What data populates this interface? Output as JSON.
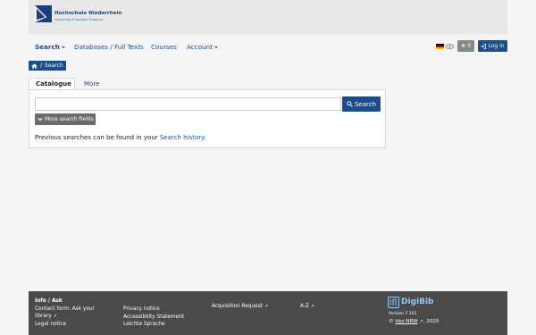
{
  "header": {
    "logo_name": "Hochschule Niederrhein",
    "logo_sub": "University of Applied Sciences"
  },
  "nav": {
    "search": "Search",
    "databases": "Databases / Full Texts",
    "courses": "Courses",
    "account": "Account",
    "bookmark_count": "0",
    "login": "Log in"
  },
  "breadcrumb": {
    "label": "Search"
  },
  "tabs": [
    {
      "label": "Catalogue"
    },
    {
      "label": "More"
    }
  ],
  "search": {
    "value": "",
    "button": "Search",
    "more_fields": "More search fields",
    "previous_text": "Previous searches can be found in your",
    "history_link": "Search history",
    "period": "."
  },
  "footer": {
    "col1": {
      "heading": "Info / Ask",
      "contact": "Contact form: Ask your",
      "library": "library",
      "legal": "Legal notice"
    },
    "col2": {
      "privacy": "Privacy notice",
      "accessibility": "Accessibility Statement",
      "easy_language": "Leichte Sprache"
    },
    "col3": {
      "acquisition": "Acquisition Request"
    },
    "col4": {
      "az": "A-Z"
    },
    "brand": {
      "name": "DigiBib",
      "version": "Version 7.101",
      "copy_prefix": "©",
      "hbz": "hbz NRW",
      "year": ", 2025"
    }
  },
  "colors": {
    "primary": "#1c4e8c",
    "footer_bg": "#4a4a4a",
    "brand": "#8ecbf5"
  }
}
